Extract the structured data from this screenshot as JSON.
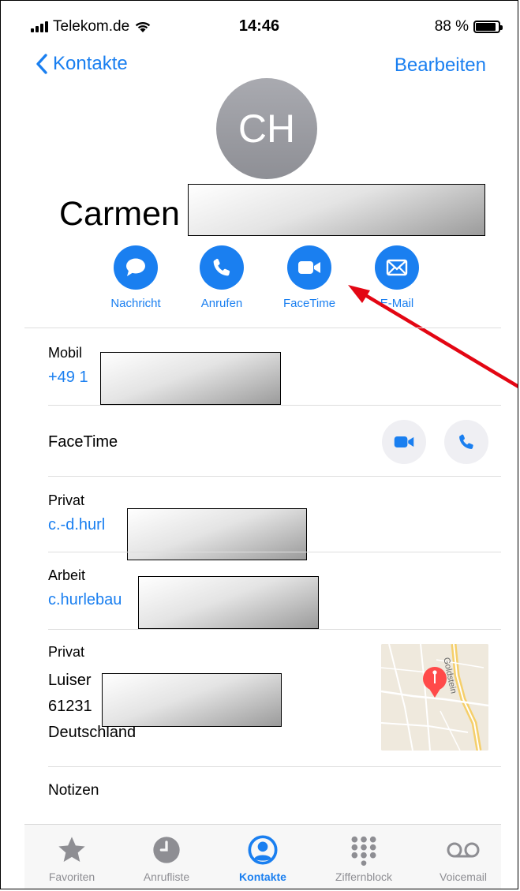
{
  "status": {
    "carrier": "Telekom.de",
    "time": "14:46",
    "battery": "88 %"
  },
  "nav": {
    "back_label": "Kontakte",
    "edit_label": "Bearbeiten"
  },
  "contact": {
    "initials": "CH",
    "first_name": "Carmen"
  },
  "actions": [
    {
      "label": "Nachricht",
      "icon": "message-bubble-icon"
    },
    {
      "label": "Anrufen",
      "icon": "phone-icon"
    },
    {
      "label": "FaceTime",
      "icon": "video-camera-icon"
    },
    {
      "label": "E-Mail",
      "icon": "envelope-icon"
    }
  ],
  "fields": {
    "mobile_label": "Mobil",
    "mobile_value": "+49 1",
    "facetime_label": "FaceTime",
    "email_private_label": "Privat",
    "email_private_value": "c.-d.hurl",
    "email_work_label": "Arbeit",
    "email_work_value": "c.hurlebau",
    "address_label": "Privat",
    "address_line1": "Luiser",
    "address_line2": "61231",
    "address_country": "Deutschland",
    "notes_label": "Notizen"
  },
  "map": {
    "street_label": "Goldstein"
  },
  "tabs": [
    {
      "label": "Favoriten",
      "icon": "star-icon"
    },
    {
      "label": "Anrufliste",
      "icon": "clock-icon"
    },
    {
      "label": "Kontakte",
      "icon": "person-circle-icon",
      "active": true
    },
    {
      "label": "Ziffernblock",
      "icon": "keypad-icon"
    },
    {
      "label": "Voicemail",
      "icon": "voicemail-icon"
    }
  ],
  "colors": {
    "accent": "#1a7ff0",
    "annotation_arrow": "#e30613"
  }
}
